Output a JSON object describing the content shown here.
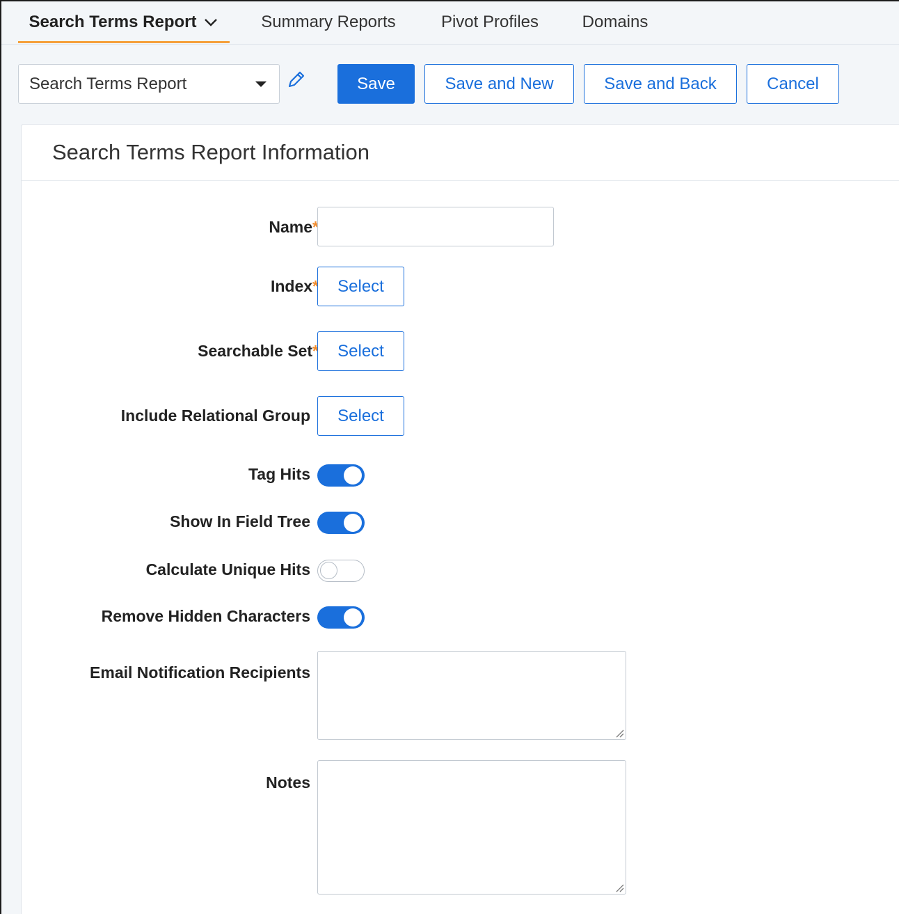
{
  "tabs": [
    {
      "label": "Search Terms Report",
      "active": true
    },
    {
      "label": "Summary Reports",
      "active": false
    },
    {
      "label": "Pivot Profiles",
      "active": false
    },
    {
      "label": "Domains",
      "active": false
    }
  ],
  "toolbar": {
    "layout_select_value": "Search Terms Report",
    "save_label": "Save",
    "save_new_label": "Save and New",
    "save_back_label": "Save and Back",
    "cancel_label": "Cancel"
  },
  "card": {
    "title": "Search Terms Report Information",
    "fields": {
      "name_label": "Name",
      "index_label": "Index",
      "searchable_set_label": "Searchable Set",
      "relational_group_label": "Include Relational Group",
      "tag_hits_label": "Tag Hits",
      "show_field_tree_label": "Show In Field Tree",
      "unique_hits_label": "Calculate Unique Hits",
      "hidden_chars_label": "Remove Hidden Characters",
      "email_label": "Email Notification Recipients",
      "notes_label": "Notes",
      "required_mark": "*",
      "select_label": "Select"
    },
    "toggles": {
      "tag_hits": true,
      "show_in_field_tree": true,
      "calculate_unique_hits": false,
      "remove_hidden_characters": true
    }
  },
  "colors": {
    "accent": "#1a6fdc",
    "required": "#f08b2c",
    "active_tab_underline": "#f5a03c"
  },
  "icons": [
    "chevron-down-icon",
    "dropdown-caret-icon",
    "pencil-icon",
    "resize-grip-icon"
  ]
}
